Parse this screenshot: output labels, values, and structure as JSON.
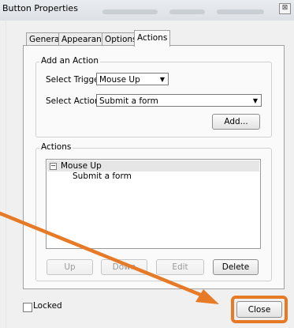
{
  "window": {
    "title": "Button Properties",
    "close_glyph": "⊠"
  },
  "tabs": [
    {
      "label": "General",
      "active": false
    },
    {
      "label": "Appearance",
      "active": false
    },
    {
      "label": "Options",
      "active": false
    },
    {
      "label": "Actions",
      "active": true
    }
  ],
  "add_action": {
    "group_label": "Add an Action",
    "trigger_label": "Select Trigger:",
    "trigger_value": "Mouse Up",
    "action_label": "Select Action:",
    "action_value": "Submit a form",
    "add_button": "Add..."
  },
  "actions": {
    "group_label": "Actions",
    "tree": [
      {
        "label": "Mouse Up",
        "children": [
          "Submit a form"
        ]
      }
    ],
    "expander_glyph": "−",
    "buttons": {
      "up": "Up",
      "down": "Down",
      "edit": "Edit",
      "delete": "Delete"
    }
  },
  "footer": {
    "locked_label": "Locked",
    "close_button": "Close"
  },
  "colors": {
    "annotation": "#e67a26"
  }
}
